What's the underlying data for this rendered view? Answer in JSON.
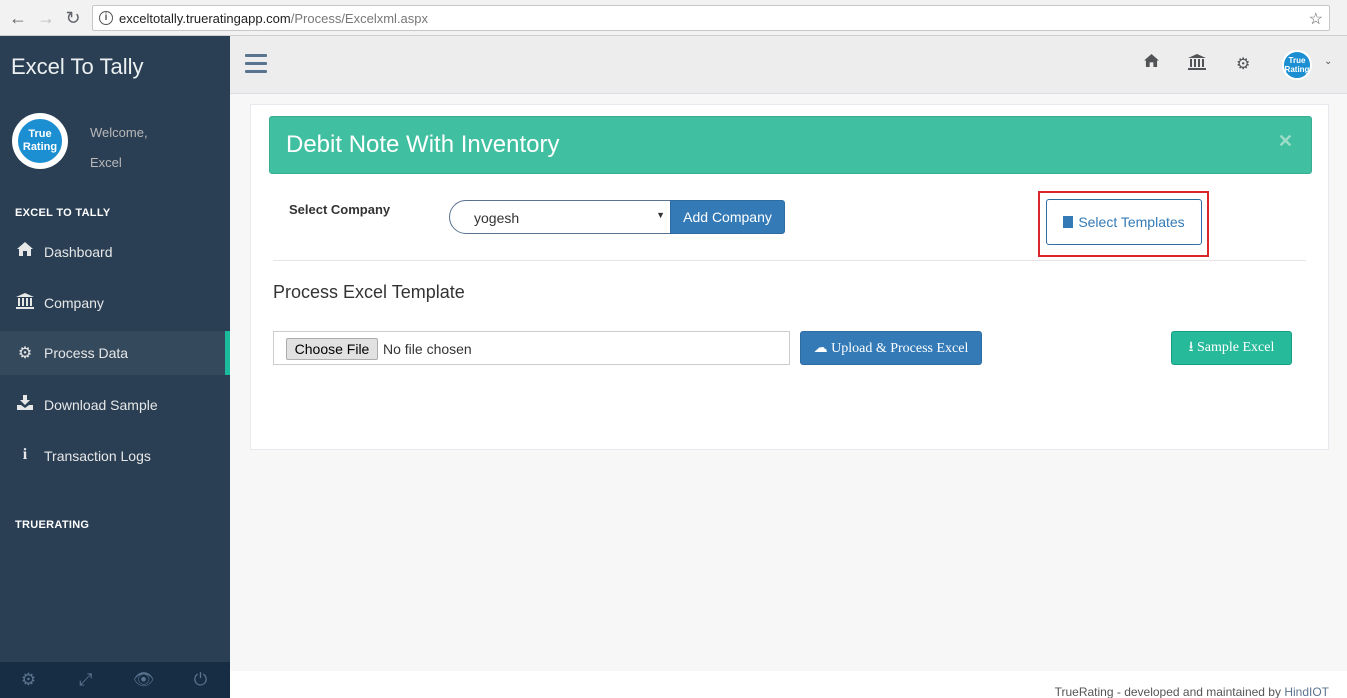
{
  "browser": {
    "url_host": "exceltotally.trueratingapp.com",
    "url_path": "/Process/Excelxml.aspx"
  },
  "sidebar": {
    "brand": "Excel To Tally",
    "avatar_text_1": "True",
    "avatar_text_2": "Rating",
    "welcome": "Welcome,",
    "username": "Excel",
    "section1_title": "EXCEL TO TALLY",
    "items": [
      {
        "label": "Dashboard",
        "icon": "home-icon"
      },
      {
        "label": "Company",
        "icon": "bank-icon"
      },
      {
        "label": "Process Data",
        "icon": "cogs-icon"
      },
      {
        "label": "Download Sample",
        "icon": "download-icon"
      },
      {
        "label": "Transaction Logs",
        "icon": "info-icon"
      }
    ],
    "section2_title": "TRUERATING",
    "footer_icons": [
      "settings-icon",
      "fullscreen-icon",
      "eye-slash-icon",
      "power-icon"
    ]
  },
  "topnav": {
    "icons": [
      "home-icon",
      "bank-icon",
      "cogs-icon"
    ],
    "avatar_text_1": "True",
    "avatar_text_2": "Rating"
  },
  "panel": {
    "alert_title": "Debit Note With Inventory",
    "company_label": "Select Company",
    "company_selected": "yogesh",
    "add_company_label": "Add Company",
    "select_templates_label": "Select Templates",
    "section_heading": "Process Excel Template",
    "choose_file_label": "Choose File",
    "no_file_text": "No file chosen",
    "upload_label": "Upload & Process Excel",
    "sample_label": "Sample Excel"
  },
  "footer": {
    "text": "TrueRating - developed and maintained by ",
    "link": "HindIOT"
  },
  "colors": {
    "sidebar_bg": "#2a3f54",
    "accent_green": "#1ABB9C",
    "alert_bg": "#40c0a0",
    "primary_blue": "#337ab7",
    "highlight_red": "#d9262c"
  }
}
